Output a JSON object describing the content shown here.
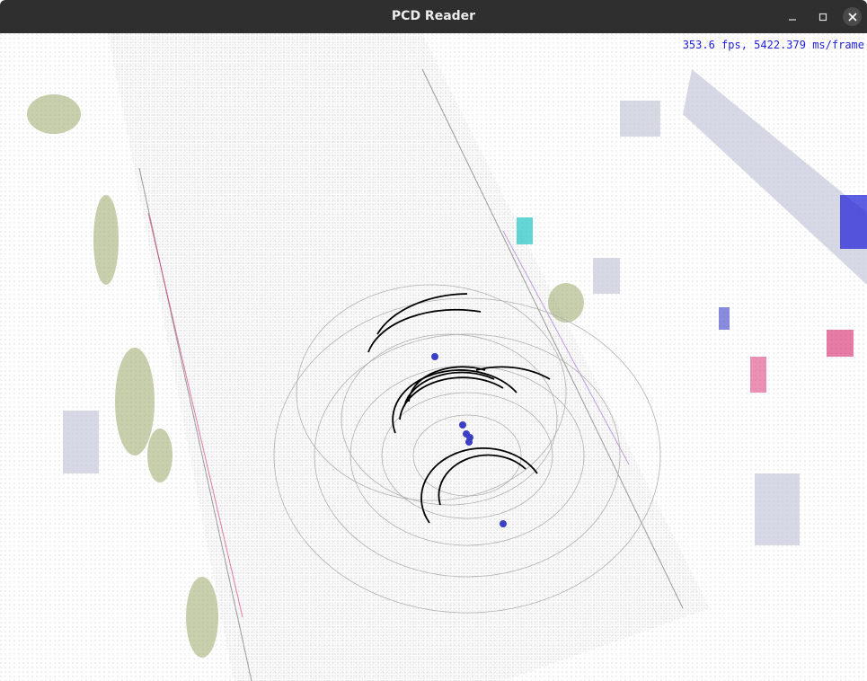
{
  "window": {
    "title": "PCD Reader"
  },
  "overlay": {
    "fps_text": "353.6 fps, 5422.379 ms/frame"
  },
  "controls": {
    "minimize": "minimize-icon",
    "maximize": "maximize-icon",
    "close": "close-icon"
  },
  "colors": {
    "titlebar": "#2f2f2f",
    "fps_text": "#2020e0",
    "points": "#9a9a9a",
    "highlight_rings": "#000000",
    "markers": "#3b3fc4",
    "vegetation": "#9aa86a",
    "accent_red": "#d6246a",
    "accent_cyan": "#22c4c4"
  }
}
